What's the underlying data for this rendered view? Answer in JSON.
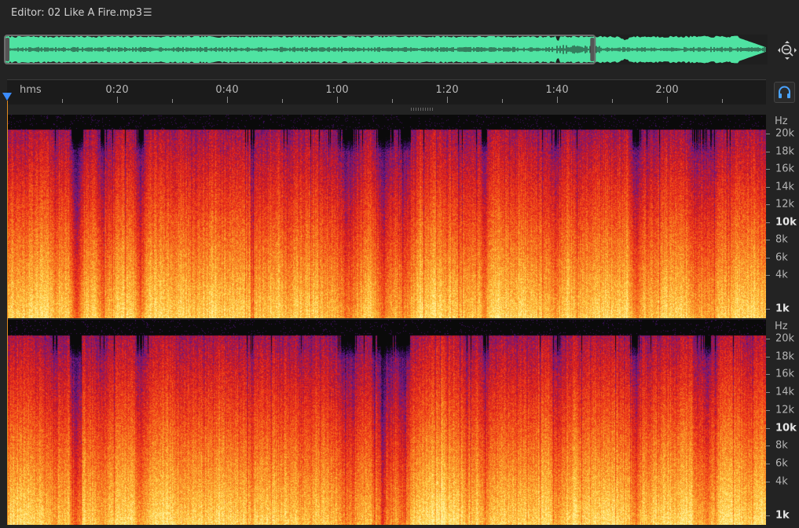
{
  "editor": {
    "title": "Editor: 02 Like A Fire.mp3",
    "menu_icon": "hamburger-menu-icon"
  },
  "overview": {
    "waveform_color": "#4fe3a2",
    "viewport_range_fraction": [
      0.0,
      0.775
    ]
  },
  "timeline": {
    "units_label": "hms",
    "labels": [
      "0:20",
      "0:40",
      "1:00",
      "1:20",
      "1:40",
      "2:00"
    ],
    "label_seconds": [
      20,
      40,
      60,
      80,
      100,
      120
    ],
    "minor_tick_seconds": [
      10,
      30,
      50,
      70,
      90,
      110,
      130
    ],
    "visible_duration_seconds": 138
  },
  "spectral": {
    "unit_label": "Hz",
    "frequency_labels": [
      {
        "text": "20k",
        "hz": 20000,
        "bold": false
      },
      {
        "text": "18k",
        "hz": 18000,
        "bold": false
      },
      {
        "text": "16k",
        "hz": 16000,
        "bold": false
      },
      {
        "text": "14k",
        "hz": 14000,
        "bold": false
      },
      {
        "text": "12k",
        "hz": 12000,
        "bold": false
      },
      {
        "text": "10k",
        "hz": 10000,
        "bold": true
      },
      {
        "text": "8k",
        "hz": 8000,
        "bold": false
      },
      {
        "text": "6k",
        "hz": 6000,
        "bold": false
      },
      {
        "text": "4k",
        "hz": 4000,
        "bold": false
      },
      {
        "text": "1k",
        "hz": 1000,
        "bold": true
      }
    ],
    "max_hz": 22050,
    "colormap": [
      "#0a0a0a",
      "#3a0e5e",
      "#6a1a8a",
      "#b8152e",
      "#e8281a",
      "#f5601a",
      "#fb9a2a",
      "#ffd24a",
      "#fff2a0"
    ]
  },
  "controls": {
    "zoom_icon": "zoom-magnifier-icon",
    "headphone_icon": "headphones-icon",
    "playhead_color": "#3b8cff"
  }
}
